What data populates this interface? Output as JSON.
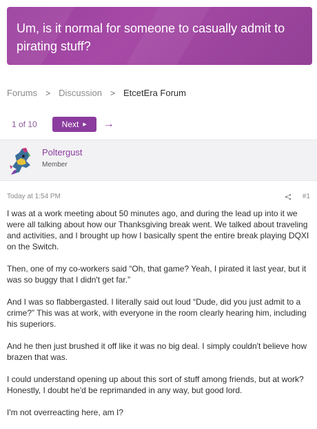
{
  "thread": {
    "title": "Um, is it normal for someone to casually admit to pirating stuff?"
  },
  "breadcrumb": {
    "items": [
      "Forums",
      "Discussion",
      "EtcetEra Forum"
    ],
    "separator": ">"
  },
  "pagination": {
    "page_count": "1 of 10",
    "next_label": "Next",
    "next_icon": "caret-right-icon",
    "arrow_icon": "arrow-right-icon"
  },
  "post": {
    "author": "Poltergust",
    "author_title": "Member",
    "timestamp": "Today at 1:54 PM",
    "share_icon": "share-icon",
    "number": "#1",
    "paragraphs": [
      "I was at a work meeting about 50 minutes ago, and during the lead up into it we were all talking about how our Thanksgiving break went. We talked about traveling and activities, and I brought up how I basically spent the entire break playing DQXI on the Switch.",
      "Then, one of my co-workers said “Oh, that game? Yeah, I pirated it last year, but it was so buggy that I didn't get far.”",
      "And I was so flabbergasted. I literally said out loud “Dude, did you just admit to a crime?” This was at work, with everyone in the room clearly hearing him, including his superiors.",
      "And he then just brushed it off like it was no big deal. I simply couldn't believe how brazen that was.",
      "I could understand opening up about this sort of stuff among friends, but at work? Honestly, I doubt he'd be reprimanded in any way, but good lord.",
      "I'm not overreacting here, am I?"
    ]
  },
  "colors": {
    "accent": "#8b3c9e",
    "banner": "#a04aa3",
    "member_bar": "#f2f2f4"
  }
}
